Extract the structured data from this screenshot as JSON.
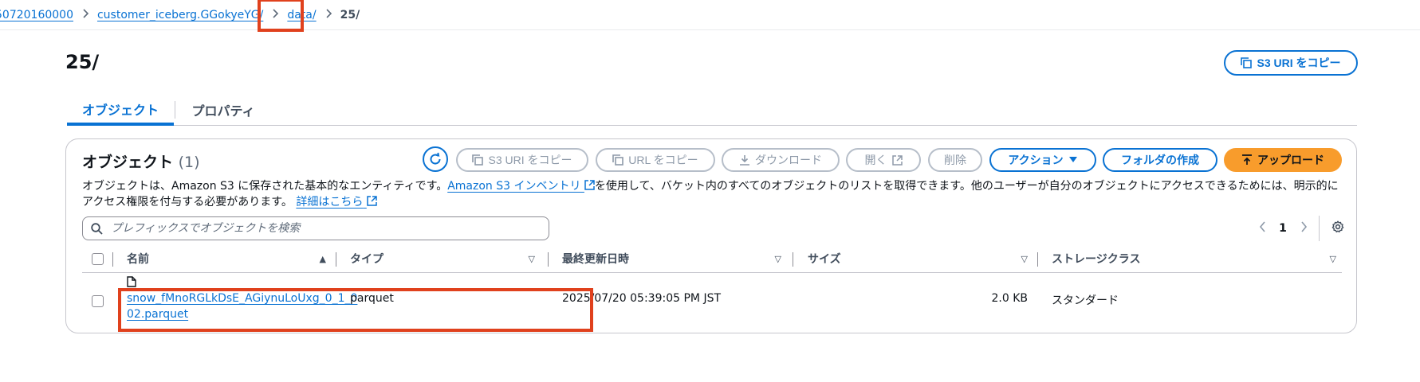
{
  "breadcrumb": {
    "items": [
      "50720160000",
      "customer_iceberg.GGokyeYG/",
      "data/"
    ],
    "current": "25/"
  },
  "page": {
    "title": "25/",
    "copy_s3_uri_label": "S3 URI をコピー"
  },
  "tabs": {
    "objects": "オブジェクト",
    "properties": "プロパティ"
  },
  "objects_panel": {
    "title": "オブジェクト",
    "count": "(1)",
    "buttons": {
      "copy_s3_uri": "S3 URI をコピー",
      "copy_url": "URL をコピー",
      "download": "ダウンロード",
      "open": "開く",
      "delete": "削除",
      "actions": "アクション",
      "create_folder": "フォルダの作成",
      "upload": "アップロード"
    },
    "description": {
      "part1": "オブジェクトは、Amazon S3 に保存された基本的なエンティティです。",
      "inventory_link": "Amazon S3 インベントリ",
      "part2": "を使用して、バケット内のすべてのオブジェクトのリストを取得できます。他のユーザーが自分のオブジェクトにアクセスできるためには、明示的にア",
      "part3": "クセス権限を付与する必要があります。",
      "details_link": "詳細はこちら"
    },
    "search": {
      "placeholder": "プレフィックスでオブジェクトを検索"
    },
    "pagination": {
      "current_page": "1"
    },
    "columns": {
      "name": "名前",
      "type": "タイプ",
      "last_modified": "最終更新日時",
      "size": "サイズ",
      "storage_class": "ストレージクラス"
    },
    "rows": [
      {
        "name_line1": "snow_fMnoRGLkDsE_AGiynuLoUxg_0_1_0",
        "name_line2": "02.parquet",
        "type": "parquet",
        "last_modified": "2025/07/20 05:39:05 PM JST",
        "size": "2.0 KB",
        "storage_class": "スタンダード"
      }
    ]
  },
  "colors": {
    "link": "#0972d3",
    "primary_button": "#f89c2c",
    "highlight_box": "#e0411d"
  }
}
